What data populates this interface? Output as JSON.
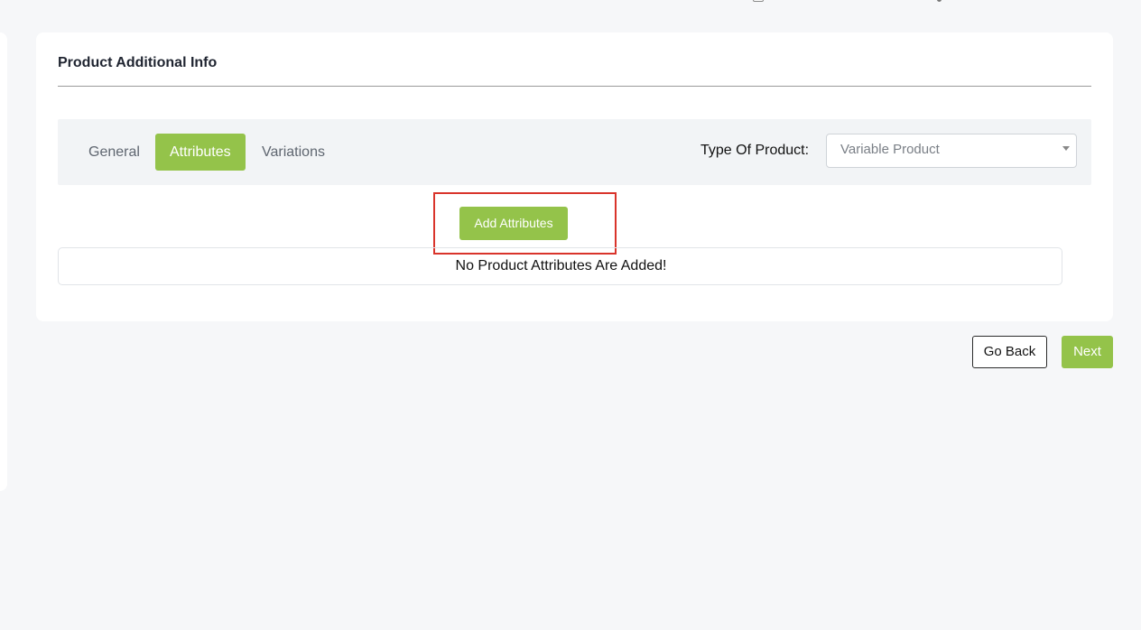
{
  "card": {
    "title": "Product Additional Info"
  },
  "tabs": [
    {
      "label": "General",
      "active": false
    },
    {
      "label": "Attributes",
      "active": true
    },
    {
      "label": "Variations",
      "active": false
    }
  ],
  "product_type": {
    "label": "Type Of Product:",
    "selected": "Variable Product"
  },
  "attributes": {
    "add_button_label": "Add Attributes",
    "empty_message": "No Product Attributes Are Added!"
  },
  "footer": {
    "go_back_label": "Go Back",
    "next_label": "Next"
  },
  "colors": {
    "accent": "#94c34a",
    "highlight": "#d9342b"
  }
}
